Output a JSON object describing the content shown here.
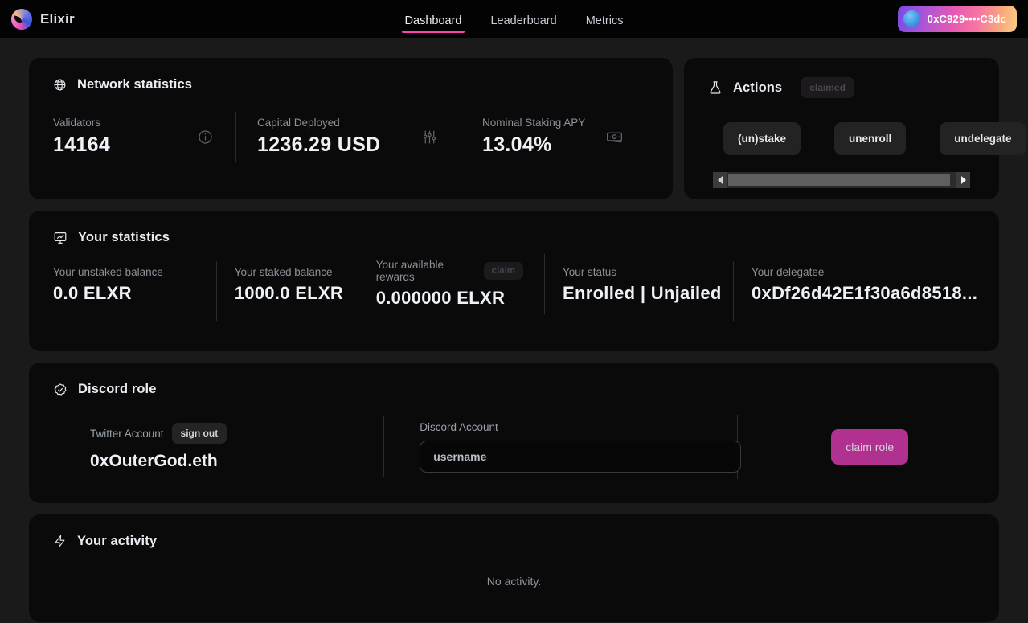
{
  "header": {
    "brand": "Elixir",
    "brand_logo_icon": "elixir-logo-icon",
    "nav": [
      {
        "label": "Dashboard",
        "active": true
      },
      {
        "label": "Leaderboard",
        "active": false
      },
      {
        "label": "Metrics",
        "active": false
      }
    ],
    "wallet": {
      "address": "0xC929••••C3dc",
      "avatar_icon": "wallet-avatar-icon",
      "gradient_from": "#7b4ae0",
      "gradient_to": "#fbcf86"
    }
  },
  "network_statistics": {
    "title": "Network statistics",
    "icon": "globe-icon",
    "stats": [
      {
        "label": "Validators",
        "value": "14164",
        "icon": "info-icon"
      },
      {
        "label": "Capital Deployed",
        "value": "1236.29 USD",
        "icon": "sliders-icon"
      },
      {
        "label": "Nominal Staking APY",
        "value": "13.04%",
        "icon": "banknote-icon"
      }
    ]
  },
  "actions": {
    "title": "Actions",
    "icon": "flask-icon",
    "badge": "claimed",
    "buttons": [
      {
        "label": "(un)stake"
      },
      {
        "label": "unenroll"
      },
      {
        "label": "undelegate"
      }
    ],
    "scrollbar": {
      "left_arrow": "◀",
      "right_arrow": "▶"
    }
  },
  "your_statistics": {
    "title": "Your statistics",
    "icon": "chart-presentation-icon",
    "stats": [
      {
        "label": "Your unstaked balance",
        "value": "0.0 ELXR"
      },
      {
        "label": "Your staked balance",
        "value": "1000.0 ELXR"
      },
      {
        "label": "Your available rewards",
        "value": "0.000000 ELXR",
        "badge": "claim"
      },
      {
        "label": "Your status",
        "value": "Enrolled | Unjailed"
      },
      {
        "label": "Your delegatee",
        "value": "0xDf26d42E1f30a6d8518..."
      }
    ]
  },
  "discord_role": {
    "title": "Discord role",
    "icon": "check-badge-icon",
    "twitter_label": "Twitter Account",
    "sign_out_label": "sign out",
    "twitter_handle": "0xOuterGod.eth",
    "discord_label": "Discord Account",
    "discord_value": "",
    "discord_placeholder": "username",
    "claim_role_label": "claim role",
    "claim_role_color": "#b0318f"
  },
  "your_activity": {
    "title": "Your activity",
    "icon": "lightning-bolt-icon",
    "empty_text": "No activity."
  }
}
